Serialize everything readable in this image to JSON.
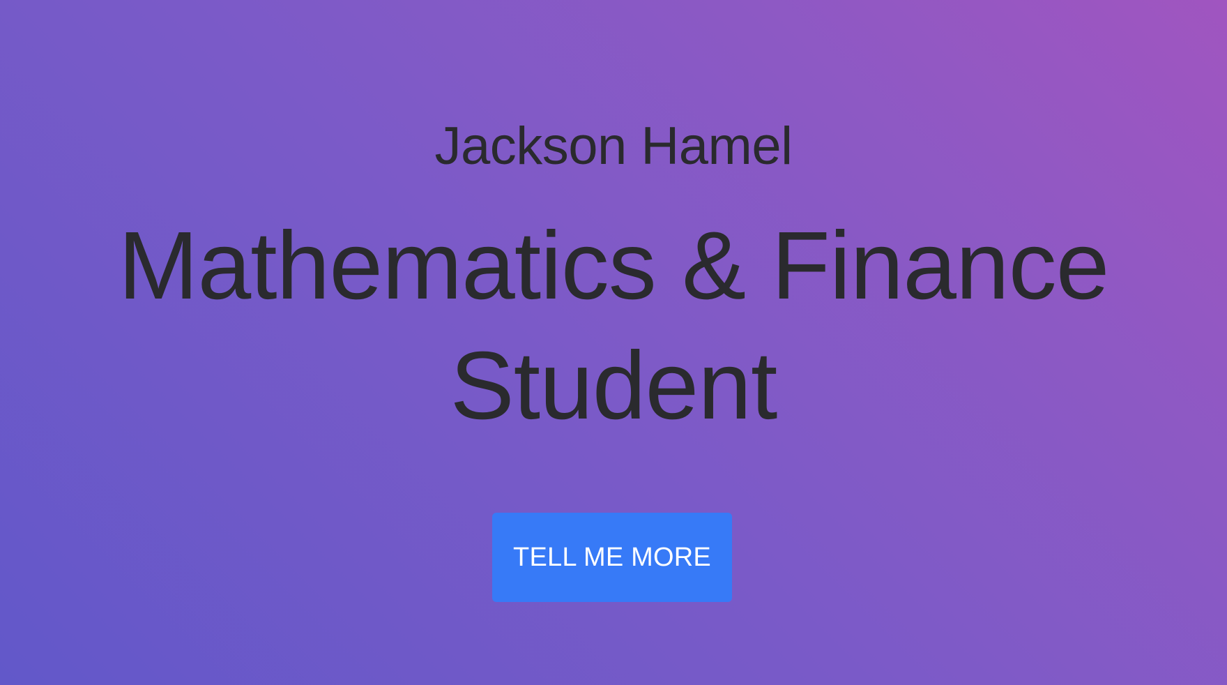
{
  "hero": {
    "name": "Jackson Hamel",
    "headline_line1": "Mathematics & Finance",
    "headline_line2": "Student",
    "cta_label": "TELL ME MORE"
  },
  "colors": {
    "gradient_start": "#6258c9",
    "gradient_end": "#a055c0",
    "text": "#2a2a2e",
    "button": "#377af7",
    "button_text": "#ffffff"
  }
}
